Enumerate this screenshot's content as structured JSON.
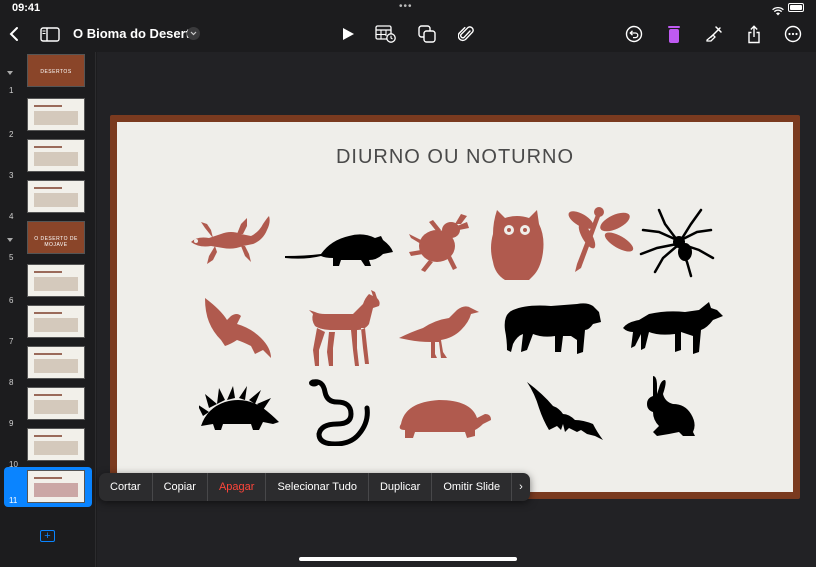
{
  "status": {
    "time": "09:41",
    "dots": "•••"
  },
  "toolbar": {
    "doc_title": "O Bioma do Deserto",
    "back_icon": "chevron-left-icon",
    "sidebar_icon": "sidebar-icon",
    "title_menu_icon": "chevron-down-icon",
    "play_icon": "play-icon",
    "table_icon": "table-icon",
    "shapes_icon": "shapes-icon",
    "attach_icon": "paperclip-icon",
    "undo_icon": "undo-icon",
    "format_icon": "format-icon",
    "brush_icon": "paintbrush-icon",
    "share_icon": "share-icon",
    "more_icon": "more-icon",
    "accent": "#bf5af2"
  },
  "sidebar": {
    "slides": [
      {
        "num": "1",
        "label": "DESERTOS",
        "collapsible": true
      },
      {
        "num": "2",
        "label": ""
      },
      {
        "num": "3",
        "label": ""
      },
      {
        "num": "4",
        "label": ""
      },
      {
        "num": "5",
        "label": "O DESERTO DE MOJAVE",
        "collapsible": true
      },
      {
        "num": "6",
        "label": ""
      },
      {
        "num": "7",
        "label": ""
      },
      {
        "num": "8",
        "label": ""
      },
      {
        "num": "9",
        "label": ""
      },
      {
        "num": "10",
        "label": ""
      },
      {
        "num": "11",
        "label": ""
      }
    ],
    "add_icon": "plus-icon",
    "selected_color": "#0a84ff"
  },
  "slide": {
    "title": "DIURNO OU NOTURNO",
    "frame_color": "#7a3a1f",
    "red_color": "#b05a4e",
    "black_color": "#000000",
    "animals": [
      "lizard",
      "rat",
      "beetle",
      "owl",
      "dragonfly",
      "spider",
      "hawk",
      "deer",
      "crow",
      "tiger",
      "wolf",
      "porcupine",
      "snake",
      "tortoise",
      "bat",
      "rabbit"
    ]
  },
  "context_menu": {
    "items": [
      "Cortar",
      "Copiar",
      "Apagar",
      "Selecionar Tudo",
      "Duplicar",
      "Omitir Slide",
      "›"
    ]
  }
}
